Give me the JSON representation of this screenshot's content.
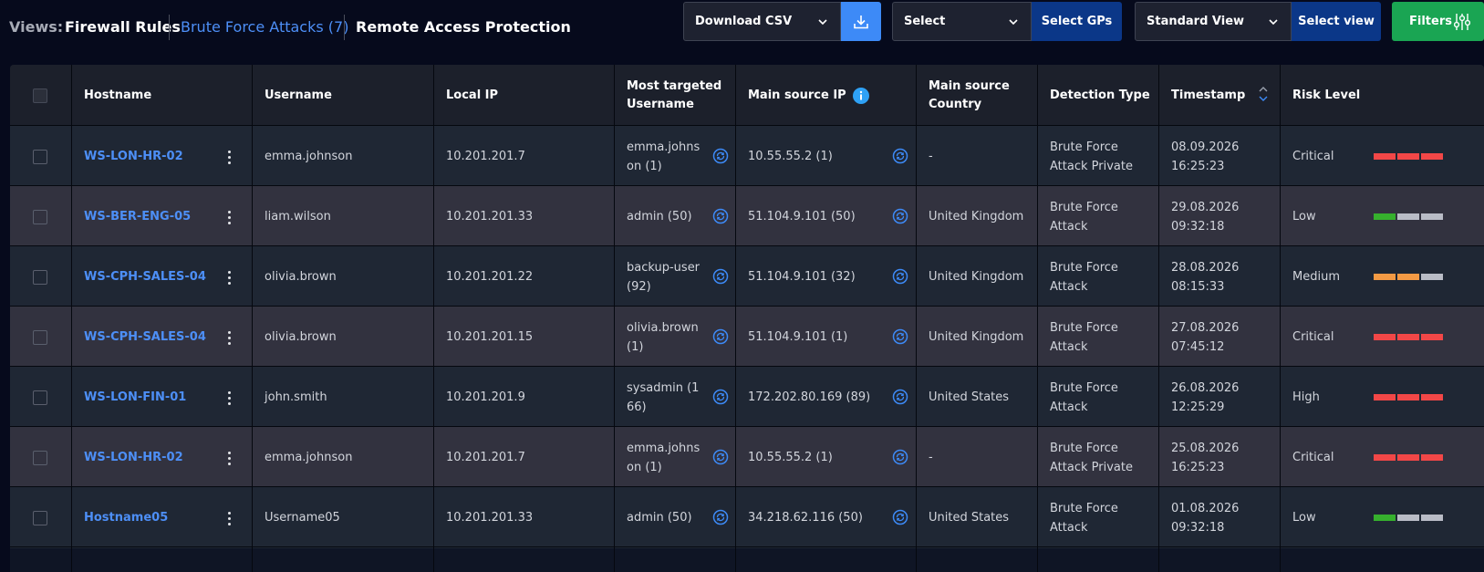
{
  "views": {
    "label": "Views:",
    "tabs": [
      {
        "label": "Firewall Rules",
        "active": false
      },
      {
        "label": "Brute Force Attacks (7)",
        "active": true
      },
      {
        "label": "Remote Access Protection",
        "active": false
      }
    ]
  },
  "toolbar": {
    "download_select": "Download CSV",
    "gp_select": "Select",
    "gp_button": "Select GPs",
    "view_select": "Standard View",
    "view_button": "Select view",
    "filters_button": "Filters"
  },
  "colors": {
    "accent_blue": "#3d8af7",
    "link_blue": "#4d8ff7",
    "dark_blue": "#0b3788",
    "green": "#1aa553",
    "risk_red": "#f24747",
    "risk_orange": "#f39a44",
    "risk_green": "#36b02d",
    "risk_empty": "#b9bcc6"
  },
  "table": {
    "headers": {
      "hostname": "Hostname",
      "username": "Username",
      "local_ip": "Local IP",
      "most_targeted_1": "Most targeted",
      "most_targeted_2": "Username",
      "main_source_ip": "Main source IP",
      "main_source_country_1": "Main source",
      "main_source_country_2": "Country",
      "detection_type": "Detection Type",
      "timestamp": "Timestamp",
      "risk_level": "Risk Level"
    },
    "rows": [
      {
        "hostname": "WS-LON-HR-02",
        "username": "emma.johnson",
        "local_ip": "10.201.201.7",
        "most_targeted": "emma.johnson (1)",
        "source_ip": "10.55.55.2 (1)",
        "country": "-",
        "detection_1": "Brute Force",
        "detection_2": "Attack Private",
        "date": "08.09.2026",
        "time": "16:25:23",
        "risk": "Critical",
        "risk_level": 3
      },
      {
        "hostname": "WS-BER-ENG-05",
        "username": "liam.wilson",
        "local_ip": "10.201.201.33",
        "most_targeted": "admin (50)",
        "source_ip": "51.104.9.101 (50)",
        "country": "United Kingdom",
        "detection_1": "Brute Force",
        "detection_2": "Attack",
        "date": "29.08.2026",
        "time": "09:32:18",
        "risk": "Low",
        "risk_level": 1
      },
      {
        "hostname": "WS-CPH-SALES-04",
        "username": "olivia.brown",
        "local_ip": "10.201.201.22",
        "most_targeted": "backup-user (92)",
        "source_ip": "51.104.9.101 (32)",
        "country": "United Kingdom",
        "detection_1": "Brute Force",
        "detection_2": "Attack",
        "date": "28.08.2026",
        "time": "08:15:33",
        "risk": "Medium",
        "risk_level": 2
      },
      {
        "hostname": "WS-CPH-SALES-04",
        "username": "olivia.brown",
        "local_ip": "10.201.201.15",
        "most_targeted": "olivia.brown (1)",
        "source_ip": "51.104.9.101 (1)",
        "country": "United Kingdom",
        "detection_1": "Brute Force",
        "detection_2": "Attack",
        "date": "27.08.2026",
        "time": "07:45:12",
        "risk": "Critical",
        "risk_level": 3
      },
      {
        "hostname": "WS-LON-FIN-01",
        "username": "john.smith",
        "local_ip": "10.201.201.9",
        "most_targeted": "sysadmin (166)",
        "source_ip": "172.202.80.169 (89)",
        "country": "United States",
        "detection_1": "Brute Force",
        "detection_2": "Attack",
        "date": "26.08.2026",
        "time": "12:25:29",
        "risk": "High",
        "risk_level": 3
      },
      {
        "hostname": "WS-LON-HR-02",
        "username": "emma.johnson",
        "local_ip": "10.201.201.7",
        "most_targeted": "emma.johnson (1)",
        "source_ip": "10.55.55.2 (1)",
        "country": "-",
        "detection_1": "Brute Force",
        "detection_2": "Attack Private",
        "date": "25.08.2026",
        "time": "16:25:23",
        "risk": "Critical",
        "risk_level": 3
      },
      {
        "hostname": "Hostname05",
        "username": "Username05",
        "local_ip": "10.201.201.33",
        "most_targeted": "admin (50)",
        "source_ip": "34.218.62.116 (50)",
        "country": "United States",
        "detection_1": "Brute Force",
        "detection_2": "Attack",
        "date": "01.08.2026",
        "time": "09:32:18",
        "risk": "Low",
        "risk_level": 1
      }
    ]
  }
}
